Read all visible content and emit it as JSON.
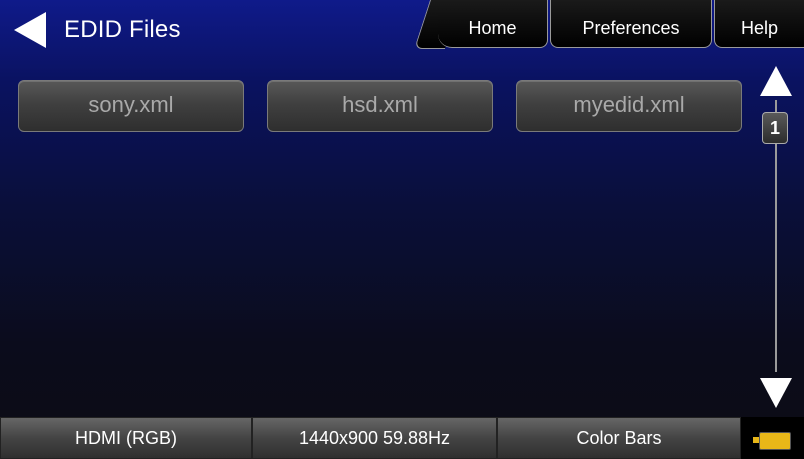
{
  "header": {
    "title": "EDID Files",
    "back_icon": "back-arrow-icon"
  },
  "nav_tabs": [
    {
      "label": "Home"
    },
    {
      "label": "Preferences"
    },
    {
      "label": "Help"
    }
  ],
  "files": [
    {
      "label": "sony.xml"
    },
    {
      "label": "hsd.xml"
    },
    {
      "label": "myedid.xml"
    }
  ],
  "pager": {
    "page": "1",
    "up_icon": "scroll-up-icon",
    "down_icon": "scroll-down-icon"
  },
  "status": {
    "interface": "HDMI (RGB)",
    "timing": "1440x900 59.88Hz",
    "image": "Color Bars",
    "battery_icon": "battery-icon",
    "battery_color": "#e8b718"
  },
  "colors": {
    "background_top": "#0f1a8a",
    "background_bottom": "#0c0c14",
    "button_text": "#a9a9a9"
  }
}
